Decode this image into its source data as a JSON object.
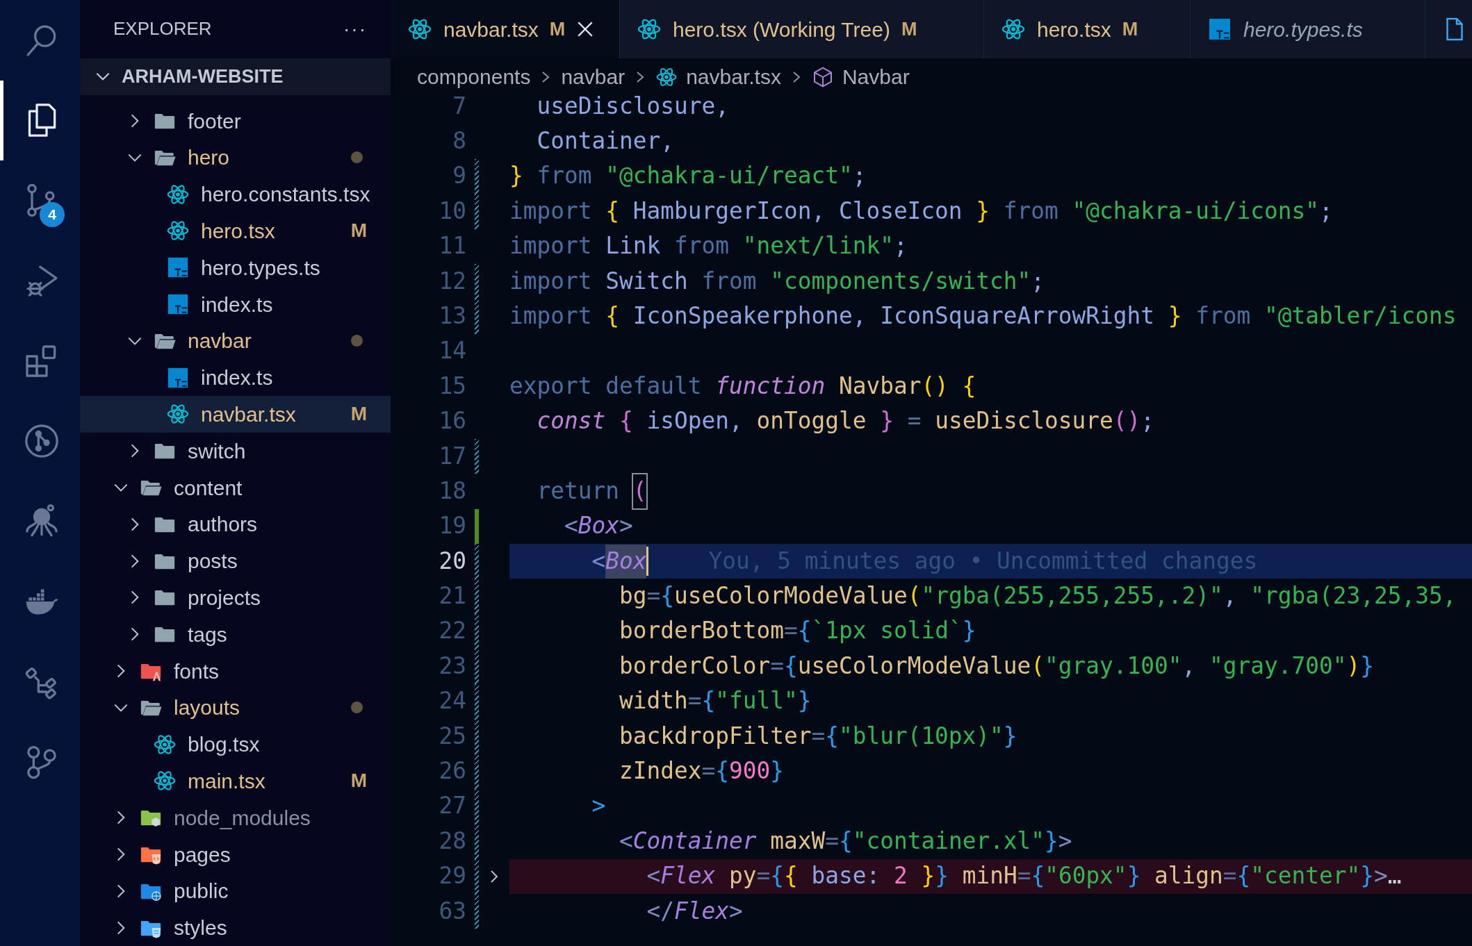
{
  "activity_bar": [
    {
      "kind": "search",
      "selected": false
    },
    {
      "kind": "files",
      "selected": true
    },
    {
      "kind": "source-control",
      "selected": false,
      "badge": "4"
    },
    {
      "kind": "run-debug",
      "selected": false
    },
    {
      "kind": "extensions",
      "selected": false
    },
    {
      "kind": "git-graph",
      "selected": false
    },
    {
      "kind": "octopus",
      "selected": false
    },
    {
      "kind": "whale",
      "selected": false
    },
    {
      "kind": "flow",
      "selected": false
    },
    {
      "kind": "branch",
      "selected": false
    }
  ],
  "sidebar": {
    "title": "EXPLORER",
    "more": "···",
    "root": {
      "label": "ARHAM-WEBSITE",
      "expanded": true
    },
    "tree": [
      {
        "children": [
          {
            "label": "footer",
            "kind": "folder",
            "expanded": false,
            "modified": false,
            "selected": false
          },
          {
            "label": "hero",
            "kind": "folder",
            "expanded": true,
            "modified": true,
            "selected": false,
            "children": [
              {
                "label": "hero.constants.tsx",
                "kind": "react",
                "modified": false,
                "selected": false
              },
              {
                "label": "hero.tsx",
                "kind": "react",
                "modified": true,
                "badge": "M",
                "selected": false
              },
              {
                "label": "hero.types.ts",
                "kind": "ts",
                "modified": false,
                "selected": false
              },
              {
                "label": "index.ts",
                "kind": "ts",
                "modified": false,
                "selected": false
              }
            ]
          },
          {
            "label": "navbar",
            "kind": "folder",
            "expanded": true,
            "modified": true,
            "selected": false,
            "children": [
              {
                "label": "index.ts",
                "kind": "ts",
                "modified": false,
                "selected": false
              },
              {
                "label": "navbar.tsx",
                "kind": "react",
                "modified": true,
                "badge": "M",
                "selected": true
              }
            ]
          },
          {
            "label": "switch",
            "kind": "folder",
            "expanded": false,
            "modified": false,
            "selected": false
          }
        ]
      },
      {
        "label": "content",
        "kind": "folder",
        "expanded": true,
        "modified": false,
        "ignored": false,
        "selected": false,
        "children": [
          {
            "label": "authors",
            "kind": "folder",
            "expanded": false,
            "modified": false,
            "selected": false
          },
          {
            "label": "posts",
            "kind": "folder",
            "expanded": false,
            "modified": false,
            "selected": false
          },
          {
            "label": "projects",
            "kind": "folder",
            "expanded": false,
            "modified": false,
            "selected": false
          },
          {
            "label": "tags",
            "kind": "folder",
            "expanded": false,
            "modified": false,
            "selected": false
          }
        ]
      },
      {
        "label": "fonts",
        "kind": "fonts",
        "expanded": false,
        "modified": false,
        "ignored": false,
        "selected": false
      },
      {
        "label": "layouts",
        "kind": "folder",
        "expanded": true,
        "modified": true,
        "ignored": false,
        "selected": false,
        "children": [
          {
            "label": "blog.tsx",
            "kind": "react",
            "modified": false,
            "selected": false
          },
          {
            "label": "main.tsx",
            "kind": "react",
            "modified": true,
            "badge": "M",
            "selected": false
          }
        ]
      },
      {
        "label": "node_modules",
        "kind": "node",
        "expanded": false,
        "modified": false,
        "ignored": true,
        "selected": false
      },
      {
        "label": "pages",
        "kind": "pages",
        "expanded": false,
        "modified": false,
        "ignored": false,
        "selected": false
      },
      {
        "label": "public",
        "kind": "public",
        "expanded": false,
        "modified": false,
        "ignored": false,
        "selected": false
      },
      {
        "label": "styles",
        "kind": "styles",
        "expanded": false,
        "modified": false,
        "ignored": false,
        "selected": false
      }
    ]
  },
  "tabs": [
    {
      "label": "navbar.tsx",
      "kind": "react",
      "modified": true,
      "badge": "M",
      "selected": true,
      "preview": false,
      "close": true
    },
    {
      "label": "hero.tsx (Working Tree)",
      "kind": "react",
      "modified": true,
      "badge": "M",
      "selected": false,
      "preview": false,
      "close": false
    },
    {
      "label": "hero.tsx",
      "kind": "react",
      "modified": true,
      "badge": "M",
      "selected": false,
      "preview": false,
      "close": false
    },
    {
      "label": "hero.types.ts",
      "kind": "ts",
      "modified": false,
      "selected": false,
      "preview": true,
      "close": false
    },
    {
      "kind": "file",
      "selected": false
    }
  ],
  "breadcrumb": [
    {
      "label": "components"
    },
    {
      "label": "navbar"
    },
    {
      "label": "navbar.tsx",
      "kind": "react"
    },
    {
      "label": "Navbar",
      "kind": "symbol"
    }
  ],
  "editor": {
    "lines": [
      {
        "number": "7",
        "modified": false,
        "added": false,
        "tokens": [
          {
            "kind": "id",
            "text": "  useDisclosure,"
          }
        ]
      },
      {
        "number": "8",
        "modified": false,
        "added": false,
        "tokens": [
          {
            "kind": "id",
            "text": "  Container,"
          }
        ]
      },
      {
        "number": "9",
        "modified": true,
        "added": false,
        "tokens": [
          {
            "kind": "br",
            "text": "}"
          },
          {
            "kind": "kw",
            "text": " from "
          },
          {
            "kind": "str",
            "text": "\"@chakra-ui/react\""
          },
          {
            "kind": "id",
            "text": ";"
          }
        ]
      },
      {
        "number": "10",
        "modified": true,
        "added": false,
        "tokens": [
          {
            "kind": "kw",
            "text": "import "
          },
          {
            "kind": "br",
            "text": "{"
          },
          {
            "kind": "id",
            "text": " HamburgerIcon, CloseIcon "
          },
          {
            "kind": "br",
            "text": "}"
          },
          {
            "kind": "kw",
            "text": " from "
          },
          {
            "kind": "str",
            "text": "\"@chakra-ui/icons\""
          },
          {
            "kind": "id",
            "text": ";"
          }
        ]
      },
      {
        "number": "11",
        "modified": false,
        "added": false,
        "tokens": [
          {
            "kind": "kw",
            "text": "import"
          },
          {
            "kind": "id",
            "text": " Link "
          },
          {
            "kind": "kw",
            "text": "from "
          },
          {
            "kind": "str",
            "text": "\"next/link\""
          },
          {
            "kind": "id",
            "text": ";"
          }
        ]
      },
      {
        "number": "12",
        "modified": true,
        "added": false,
        "tokens": [
          {
            "kind": "kw",
            "text": "import"
          },
          {
            "kind": "id",
            "text": " Switch "
          },
          {
            "kind": "kw",
            "text": "from "
          },
          {
            "kind": "str",
            "text": "\"components/switch\""
          },
          {
            "kind": "id",
            "text": ";"
          }
        ]
      },
      {
        "number": "13",
        "modified": true,
        "added": false,
        "tokens": [
          {
            "kind": "kw",
            "text": "import "
          },
          {
            "kind": "br",
            "text": "{"
          },
          {
            "kind": "id",
            "text": " IconSpeakerphone, IconSquareArrowRight "
          },
          {
            "kind": "br",
            "text": "}"
          },
          {
            "kind": "kw",
            "text": " from "
          },
          {
            "kind": "str",
            "text": "\"@tabler/icons"
          }
        ]
      },
      {
        "number": "14",
        "modified": false,
        "added": false
      },
      {
        "number": "15",
        "modified": false,
        "added": false,
        "tokens": [
          {
            "kind": "kw",
            "text": "export default "
          },
          {
            "kind": "fkw",
            "text": "function"
          },
          {
            "kind": "fn",
            "text": " Navbar"
          },
          {
            "kind": "br",
            "text": "() {"
          }
        ]
      },
      {
        "number": "16",
        "modified": false,
        "added": false,
        "tokens": [
          {
            "kind": "fkw",
            "text": "  const "
          },
          {
            "kind": "pb",
            "text": "{"
          },
          {
            "kind": "id",
            "text": " isOpen, "
          },
          {
            "kind": "fn",
            "text": "onToggle "
          },
          {
            "kind": "pb",
            "text": "}"
          },
          {
            "kind": "p",
            "text": " = "
          },
          {
            "kind": "fn",
            "text": "useDisclosure"
          },
          {
            "kind": "pb",
            "text": "()"
          },
          {
            "kind": "id",
            "text": ";"
          }
        ]
      },
      {
        "number": "17",
        "modified": true,
        "added": false
      },
      {
        "number": "18",
        "modified": false,
        "added": false,
        "tokens": [
          {
            "kind": "kw",
            "text": "  return "
          },
          {
            "kind": "match",
            "text": "("
          }
        ]
      },
      {
        "number": "19",
        "added": true,
        "tokens": [
          {
            "kind": "ang",
            "text": "    <"
          },
          {
            "kind": "tag",
            "text": "Box"
          },
          {
            "kind": "ang",
            "text": ">"
          }
        ]
      },
      {
        "number": "20",
        "modified": true,
        "added": false,
        "current": true,
        "blame": "You, 5 minutes ago • Uncommitted changes",
        "tokens": [
          {
            "kind": "ang",
            "text": "      <"
          },
          {
            "kind": "sel",
            "text": "Box"
          }
        ]
      },
      {
        "number": "21",
        "modified": true,
        "added": false,
        "tokens": [
          {
            "kind": "fn",
            "text": "        bg"
          },
          {
            "kind": "p",
            "text": "="
          },
          {
            "kind": "bb",
            "text": "{"
          },
          {
            "kind": "fn",
            "text": "useColorModeValue"
          },
          {
            "kind": "br",
            "text": "("
          },
          {
            "kind": "str",
            "text": "\"rgba(255,255,255,.2)\""
          },
          {
            "kind": "id",
            "text": ", "
          },
          {
            "kind": "str",
            "text": "\"rgba(23,25,35,"
          }
        ]
      },
      {
        "number": "22",
        "modified": true,
        "added": false,
        "tokens": [
          {
            "kind": "fn",
            "text": "        borderBottom"
          },
          {
            "kind": "p",
            "text": "="
          },
          {
            "kind": "bb",
            "text": "{"
          },
          {
            "kind": "str",
            "text": "`1px solid`"
          },
          {
            "kind": "bb",
            "text": "}"
          }
        ]
      },
      {
        "number": "23",
        "modified": true,
        "added": false,
        "tokens": [
          {
            "kind": "fn",
            "text": "        borderColor"
          },
          {
            "kind": "p",
            "text": "="
          },
          {
            "kind": "bb",
            "text": "{"
          },
          {
            "kind": "fn",
            "text": "useColorModeValue"
          },
          {
            "kind": "br",
            "text": "("
          },
          {
            "kind": "str",
            "text": "\"gray.100\""
          },
          {
            "kind": "id",
            "text": ", "
          },
          {
            "kind": "str",
            "text": "\"gray.700\""
          },
          {
            "kind": "br",
            "text": ")"
          },
          {
            "kind": "bb",
            "text": "}"
          }
        ]
      },
      {
        "number": "24",
        "modified": true,
        "added": false,
        "tokens": [
          {
            "kind": "fn",
            "text": "        width"
          },
          {
            "kind": "p",
            "text": "="
          },
          {
            "kind": "bb",
            "text": "{"
          },
          {
            "kind": "str",
            "text": "\"full\""
          },
          {
            "kind": "bb",
            "text": "}"
          }
        ]
      },
      {
        "number": "25",
        "modified": true,
        "added": false,
        "tokens": [
          {
            "kind": "fn",
            "text": "        backdropFilter"
          },
          {
            "kind": "p",
            "text": "="
          },
          {
            "kind": "bb",
            "text": "{"
          },
          {
            "kind": "str",
            "text": "\"blur(10px)\""
          },
          {
            "kind": "bb",
            "text": "}"
          }
        ]
      },
      {
        "number": "26",
        "modified": true,
        "added": false,
        "tokens": [
          {
            "kind": "fn",
            "text": "        zIndex"
          },
          {
            "kind": "p",
            "text": "="
          },
          {
            "kind": "bb",
            "text": "{"
          },
          {
            "kind": "num",
            "text": "900"
          },
          {
            "kind": "bb",
            "text": "}"
          }
        ]
      },
      {
        "number": "27",
        "modified": true,
        "added": false,
        "tokens": [
          {
            "kind": "bb",
            "text": "      >"
          }
        ]
      },
      {
        "number": "28",
        "modified": true,
        "added": false,
        "tokens": [
          {
            "kind": "ang",
            "text": "        <"
          },
          {
            "kind": "tag",
            "text": "Container"
          },
          {
            "kind": "fn",
            "text": " maxW"
          },
          {
            "kind": "p",
            "text": "="
          },
          {
            "kind": "bb",
            "text": "{"
          },
          {
            "kind": "str",
            "text": "\"container.xl\""
          },
          {
            "kind": "bb",
            "text": "}"
          },
          {
            "kind": "ang",
            "text": ">"
          }
        ]
      },
      {
        "number": "29",
        "modified": true,
        "added": false,
        "error": true,
        "folded": true,
        "tokens": [
          {
            "kind": "ang",
            "text": "          <"
          },
          {
            "kind": "tag",
            "text": "Flex"
          },
          {
            "kind": "fn",
            "text": " py"
          },
          {
            "kind": "p",
            "text": "="
          },
          {
            "kind": "bb",
            "text": "{"
          },
          {
            "kind": "br",
            "text": "{"
          },
          {
            "kind": "id",
            "text": " base: "
          },
          {
            "kind": "num",
            "text": "2"
          },
          {
            "kind": "br",
            "text": " }"
          },
          {
            "kind": "bb",
            "text": "}"
          },
          {
            "kind": "fn",
            "text": " minH"
          },
          {
            "kind": "p",
            "text": "="
          },
          {
            "kind": "bb",
            "text": "{"
          },
          {
            "kind": "str",
            "text": "\"60px\""
          },
          {
            "kind": "bb",
            "text": "}"
          },
          {
            "kind": "fn",
            "text": " align"
          },
          {
            "kind": "p",
            "text": "="
          },
          {
            "kind": "bb",
            "text": "{"
          },
          {
            "kind": "str",
            "text": "\"center\""
          },
          {
            "kind": "bb",
            "text": "}"
          },
          {
            "kind": "ang",
            "text": ">"
          },
          {
            "kind": "fold",
            "text": "…"
          }
        ]
      },
      {
        "number": "63",
        "modified": true,
        "added": false,
        "tokens": [
          {
            "kind": "ang",
            "text": "          </"
          },
          {
            "kind": "tag",
            "text": "Flex"
          },
          {
            "kind": "ang",
            "text": ">"
          }
        ]
      }
    ]
  }
}
